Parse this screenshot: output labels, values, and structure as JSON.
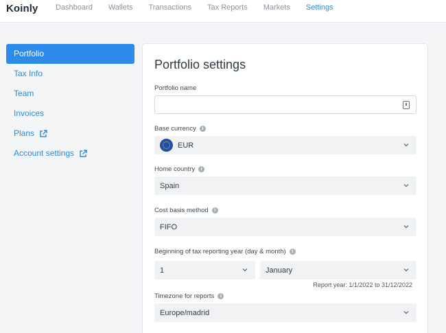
{
  "app": {
    "logo": "Koinly"
  },
  "nav": {
    "items": [
      "Dashboard",
      "Wallets",
      "Transactions",
      "Tax Reports",
      "Markets",
      "Settings"
    ],
    "active": "Settings"
  },
  "sidebar": {
    "items": [
      {
        "label": "Portfolio",
        "active": true,
        "external": false
      },
      {
        "label": "Tax Info",
        "active": false,
        "external": false
      },
      {
        "label": "Team",
        "active": false,
        "external": false
      },
      {
        "label": "Invoices",
        "active": false,
        "external": false
      },
      {
        "label": "Plans",
        "active": false,
        "external": true
      },
      {
        "label": "Account settings",
        "active": false,
        "external": true
      }
    ]
  },
  "portfolio": {
    "title": "Portfolio settings",
    "name_label": "Portfolio name",
    "name_value": "",
    "base_currency_label": "Base currency",
    "base_currency_value": "EUR",
    "home_country_label": "Home country",
    "home_country_value": "Spain",
    "cost_basis_label": "Cost basis method",
    "cost_basis_value": "FIFO",
    "tax_year_label": "Beginning of tax reporting year (day & month)",
    "tax_year_day": "1",
    "tax_year_month": "January",
    "report_year_text": "Report year: 1/1/2022 to 31/12/2022",
    "timezone_label": "Timezone for reports",
    "timezone_value": "Europe/madrid"
  },
  "colors": {
    "accent": "#2f8bea",
    "link": "#2f8bd8"
  }
}
